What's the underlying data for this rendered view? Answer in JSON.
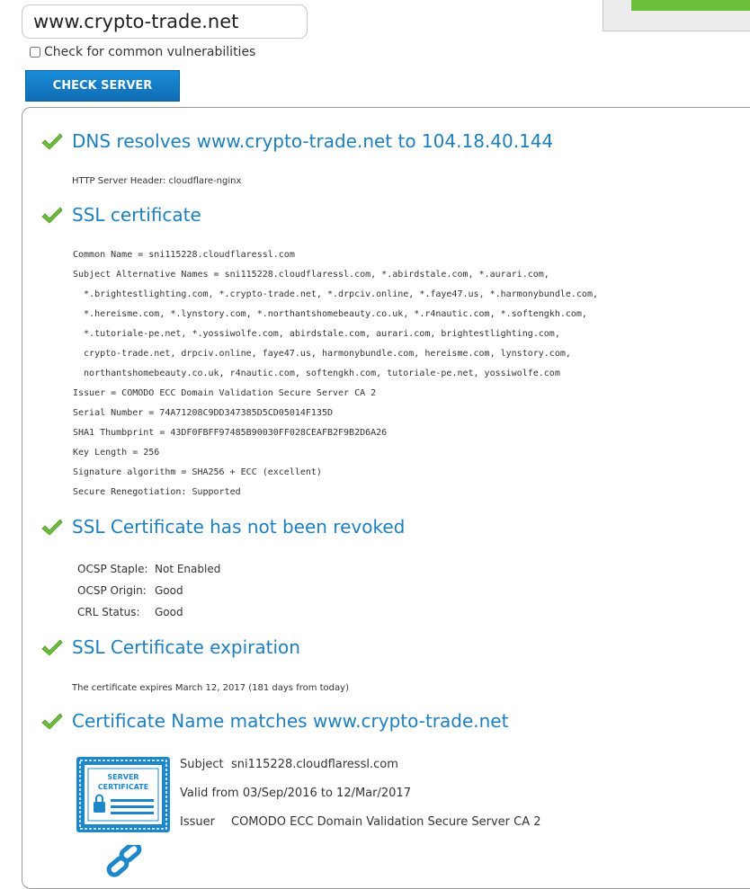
{
  "form": {
    "hostname_value": "www.crypto-trade.net",
    "vuln_label": "Check for common vulnerabilities",
    "vuln_checked": false,
    "check_button_label": "CHECK SERVER"
  },
  "dns": {
    "title": "DNS resolves www.crypto-trade.net to 104.18.40.144",
    "server_header": "HTTP Server Header: cloudflare-nginx"
  },
  "ssl": {
    "title": "SSL certificate",
    "lines": [
      "Common Name = sni115228.cloudflaressl.com",
      "Subject Alternative Names = sni115228.cloudflaressl.com, *.abirdstale.com, *.aurari.com,",
      "  *.brightestlighting.com, *.crypto-trade.net, *.drpciv.online, *.faye47.us, *.harmonybundle.com,",
      "  *.hereisme.com, *.lynstory.com, *.northantshomebeauty.co.uk, *.r4nautic.com, *.softengkh.com,",
      "  *.tutoriale-pe.net, *.yossiwolfe.com, abirdstale.com, aurari.com, brightestlighting.com,",
      "  crypto-trade.net, drpciv.online, faye47.us, harmonybundle.com, hereisme.com, lynstory.com,",
      "  northantshomebeauty.co.uk, r4nautic.com, softengkh.com, tutoriale-pe.net, yossiwolfe.com",
      "Issuer = COMODO ECC Domain Validation Secure Server CA 2",
      "Serial Number = 74A71208C9DD347385D5CD05014F135D",
      "SHA1 Thumbprint = 43DF0FBFF97485B90030FF028CEAFB2F9B2D6A26",
      "Key Length = 256",
      "Signature algorithm = SHA256 + ECC (excellent)",
      "Secure Renegotiation: Supported"
    ]
  },
  "revoked": {
    "title": "SSL Certificate has not been revoked",
    "rows": [
      {
        "label": "OCSP Staple:",
        "value": "Not Enabled"
      },
      {
        "label": "OCSP Origin:",
        "value": "Good"
      },
      {
        "label": "CRL Status:",
        "value": "Good"
      }
    ]
  },
  "expiration": {
    "title": "SSL Certificate expiration",
    "text": "The certificate expires March 12, 2017 (181 days from today)"
  },
  "name_match": {
    "title": "Certificate Name matches www.crypto-trade.net",
    "badge_line1": "SERVER",
    "badge_line2": "CERTIFICATE",
    "subject_label": "Subject",
    "subject_value": "sni115228.cloudflaressl.com",
    "valid_text": "Valid from 03/Sep/2016 to 12/Mar/2017",
    "issuer_label": "Issuer",
    "issuer_value": "COMODO ECC Domain Validation Secure Server CA 2"
  },
  "icons": {
    "check": "check-icon",
    "badge": "server-certificate-icon",
    "link": "chain-link-icon"
  },
  "colors": {
    "accent_blue": "#1e7fbe",
    "check_green": "#6bbf3a",
    "button_blue": "#1479c4"
  }
}
